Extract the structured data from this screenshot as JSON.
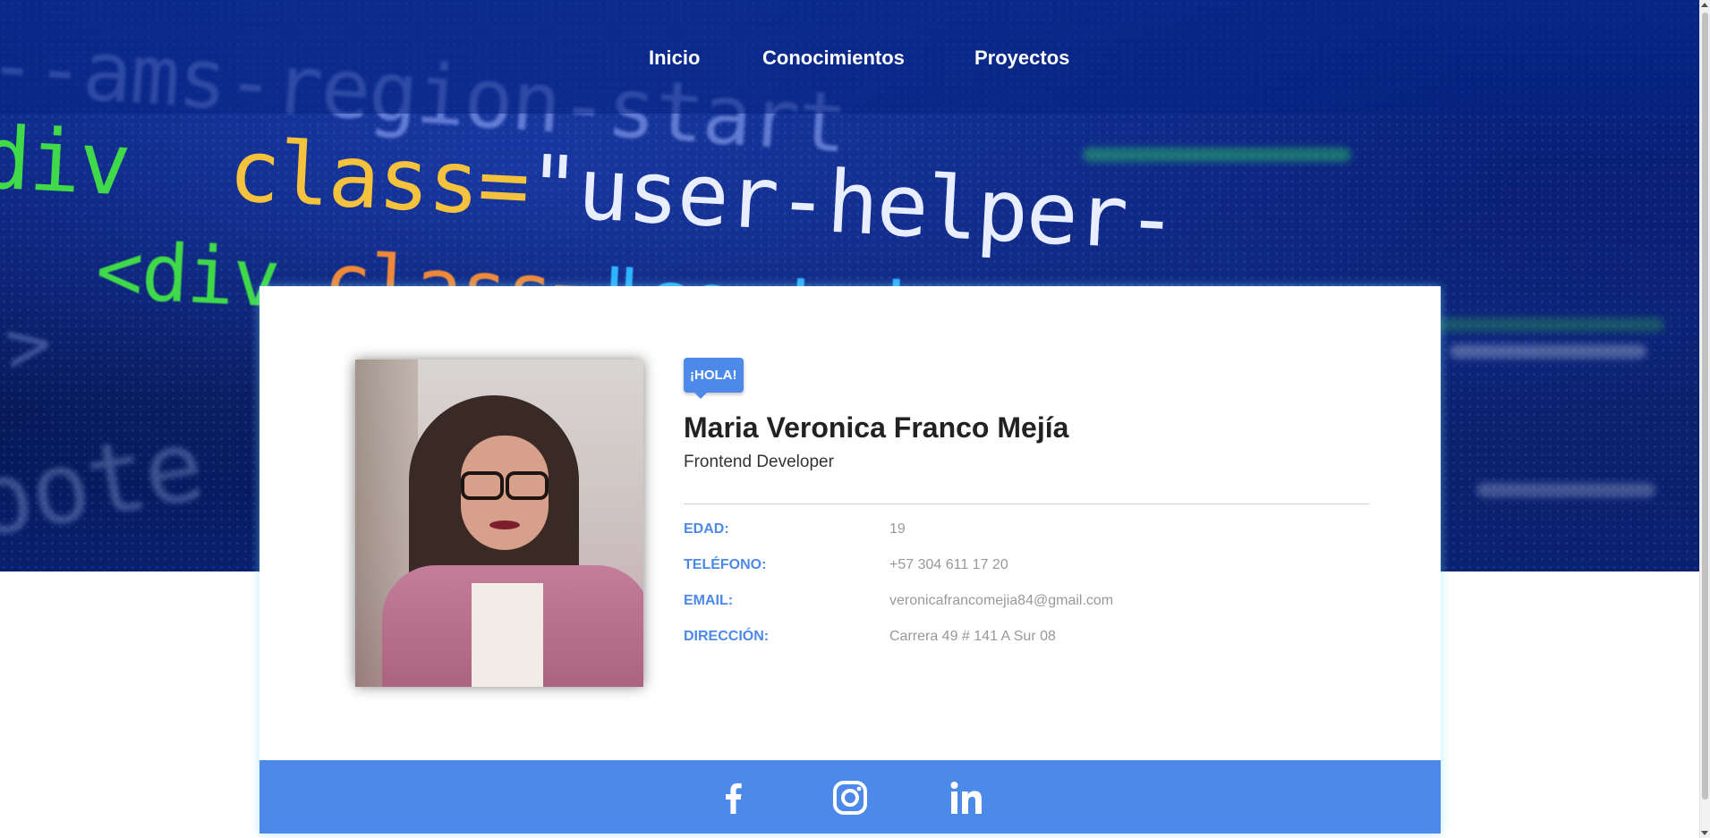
{
  "nav": {
    "items": [
      {
        "label": "Inicio"
      },
      {
        "label": "Conocimientos"
      },
      {
        "label": "Proyectos"
      }
    ]
  },
  "hero": {
    "background_code": {
      "line1": "--ams-region-start",
      "line2_tag": "div",
      "line2_attr": "class=",
      "line2_value": "\"user-helper-",
      "line3_tag": "<div",
      "line3_attr": "class=",
      "line3_value": "\"container\">",
      "line4": ">",
      "line5": "oote"
    }
  },
  "profile": {
    "greeting": "¡HOLA!",
    "name": "Maria Veronica Franco Mejía",
    "role": "Frontend Developer",
    "photo_icon": "profile-photo",
    "details": [
      {
        "label": "EDAD:",
        "value": "19"
      },
      {
        "label": "TELÉFONO:",
        "value": "+57 304 611 17 20"
      },
      {
        "label": "EMAIL:",
        "value": "veronicafrancomejia84@gmail.com"
      },
      {
        "label": "DIRECCIÓN:",
        "value": "Carrera 49 # 141 A Sur 08"
      }
    ]
  },
  "social": {
    "icons": [
      "facebook-icon",
      "instagram-icon",
      "linkedin-icon"
    ]
  },
  "colors": {
    "accent": "#4c89e8",
    "hero_dark": "#06196a",
    "label_blue": "#4c89e8",
    "value_gray": "#999999"
  }
}
